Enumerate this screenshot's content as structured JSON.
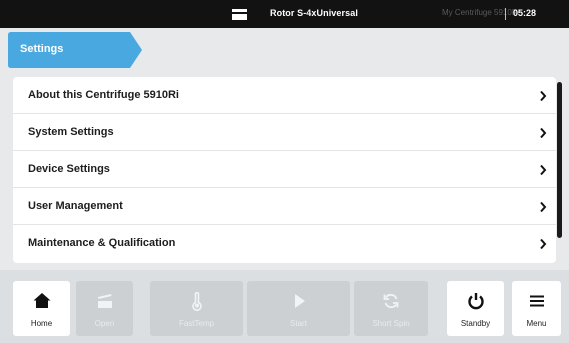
{
  "status_bar": {
    "rotor": "Rotor S-4xUniversal",
    "device_name": "My Centrifuge 5910Ri",
    "time": "05:28",
    "rotor_icon": "rotor-icon"
  },
  "breadcrumb": {
    "label": "Settings",
    "color": "#4aa8e0"
  },
  "settings_list": {
    "items": [
      {
        "label": "About this Centrifuge 5910Ri"
      },
      {
        "label": "System Settings"
      },
      {
        "label": "Device Settings"
      },
      {
        "label": "User Management"
      },
      {
        "label": "Maintenance & Qualification"
      }
    ],
    "chevron_icon": "chevron-right-icon"
  },
  "toolbar": {
    "home": {
      "label": "Home",
      "icon": "home-icon",
      "enabled": true
    },
    "open": {
      "label": "Open",
      "icon": "lid-open-icon",
      "enabled": false
    },
    "fasttemp": {
      "label": "FastTemp",
      "icon": "thermometer-icon",
      "enabled": false
    },
    "start": {
      "label": "Start",
      "icon": "play-icon",
      "enabled": false
    },
    "short_spin": {
      "label": "Short Spin",
      "icon": "refresh-icon",
      "enabled": false
    },
    "standby": {
      "label": "Standby",
      "icon": "power-icon",
      "enabled": true
    },
    "menu": {
      "label": "Menu",
      "icon": "hamburger-menu-icon",
      "enabled": true
    }
  }
}
